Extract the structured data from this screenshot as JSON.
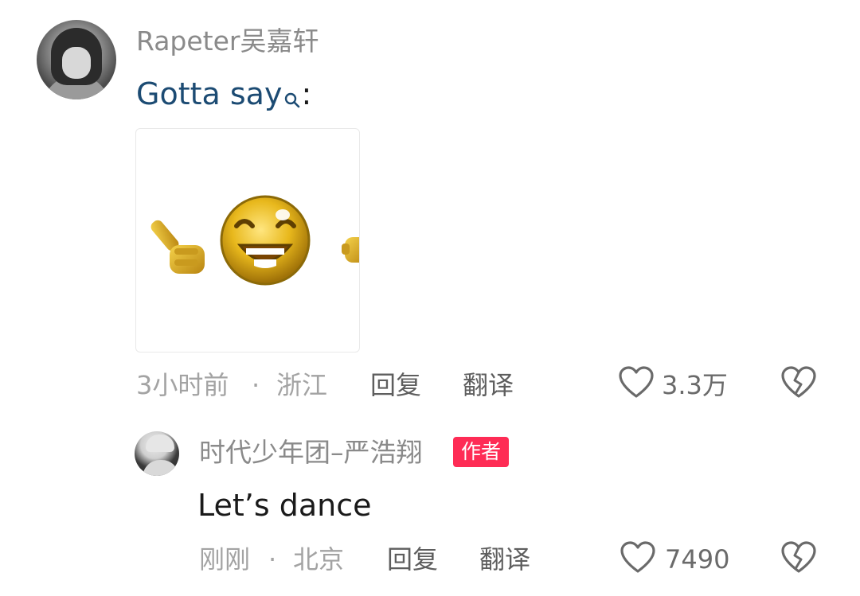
{
  "comment": {
    "username": "Rapeter吴嘉轩",
    "text": "Gotta say",
    "text_suffix": ":",
    "search_icon": "search-icon",
    "sticker": "pointing-laughing-emoji-sticker",
    "time": "3小时前",
    "separator": "·",
    "location": "浙江",
    "reply_label": "回复",
    "translate_label": "翻译",
    "like_count": "3.3万",
    "like_icon": "heart-outline-icon",
    "dislike_icon": "broken-heart-icon"
  },
  "reply": {
    "username": "时代少年团–严浩翔",
    "badge": "作者",
    "text": "Let’s dance",
    "time": "刚刚",
    "separator": "·",
    "location": "北京",
    "reply_label": "回复",
    "translate_label": "翻译",
    "like_count": "7490",
    "like_icon": "heart-outline-icon",
    "dislike_icon": "broken-heart-icon"
  },
  "colors": {
    "link_blue": "#1c4b73",
    "author_badge": "#fe2c55",
    "muted_text": "#a3a3a3",
    "username_gray": "#8a8a8a"
  }
}
